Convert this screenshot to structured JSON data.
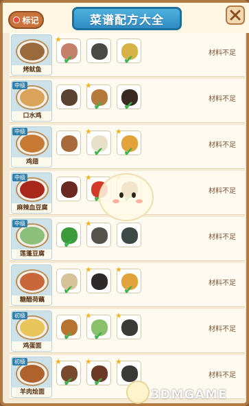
{
  "header": {
    "tag_label": "标记",
    "title": "菜谱配方大全",
    "close_icon": "close-icon"
  },
  "recipes": [
    {
      "name": "烤鱿鱼",
      "tier": "",
      "status": "材料不足",
      "food_color": "#9a6a3c",
      "ingredients": [
        {
          "icon": "squid-icon",
          "color": "#c4806a",
          "starred": true,
          "owned": true
        },
        {
          "icon": "iron-pan-icon",
          "color": "#4a4a44",
          "starred": false,
          "owned": false
        },
        {
          "icon": "oil-bottle-icon",
          "color": "#d7b347",
          "starred": false,
          "owned": true
        }
      ]
    },
    {
      "name": "口水鸡",
      "tier": "中级",
      "status": "材料不足",
      "food_color": "#d9a45a",
      "ingredients": [
        {
          "icon": "sichuan-pepper-icon",
          "color": "#5a4330",
          "starred": false,
          "owned": false
        },
        {
          "icon": "peanut-icon",
          "color": "#b47a3c",
          "starred": true,
          "owned": true
        },
        {
          "icon": "soy-sauce-icon",
          "color": "#3a2a22",
          "starred": false,
          "owned": true
        }
      ]
    },
    {
      "name": "鸡翅",
      "tier": "中级",
      "status": "材料不足",
      "food_color": "#c87a34",
      "ingredients": [
        {
          "icon": "chicken-wing-icon",
          "color": "#a86a3a",
          "starred": false,
          "owned": false
        },
        {
          "icon": "sugar-icon",
          "color": "#e8e0c8",
          "starred": true,
          "owned": true
        },
        {
          "icon": "honey-jar-icon",
          "color": "#e2a43a",
          "starred": true,
          "owned": true
        }
      ]
    },
    {
      "name": "麻辣血豆腐",
      "tier": "中级",
      "status": "材料不足",
      "food_color": "#a8281c",
      "ingredients": [
        {
          "icon": "blood-tofu-icon",
          "color": "#6a2a22",
          "starred": false,
          "owned": false
        },
        {
          "icon": "chili-icon",
          "color": "#d43a2a",
          "starred": true,
          "owned": true
        },
        {
          "icon": "spice-mix-icon",
          "color": "#b06a3a",
          "starred": true,
          "owned": true
        }
      ]
    },
    {
      "name": "莲蓬豆腐",
      "tier": "中级",
      "status": "材料不足",
      "food_color": "#8cc07a",
      "ingredients": [
        {
          "icon": "broccoli-icon",
          "color": "#3c9a3a",
          "starred": false,
          "owned": true
        },
        {
          "icon": "tofu-icon",
          "color": "#54524a",
          "starred": true,
          "owned": false
        },
        {
          "icon": "starch-bag-icon",
          "color": "#3e4a48",
          "starred": false,
          "owned": false
        }
      ]
    },
    {
      "name": "糖醋荷藕",
      "tier": "",
      "status": "材料不足",
      "food_color": "#c8683a",
      "ingredients": [
        {
          "icon": "lotus-root-icon",
          "color": "#d7c29a",
          "starred": false,
          "owned": true
        },
        {
          "icon": "vinegar-bottle-icon",
          "color": "#2e2a2a",
          "starred": true,
          "owned": false
        },
        {
          "icon": "honey-jar-icon",
          "color": "#e2a43a",
          "starred": true,
          "owned": true
        }
      ]
    },
    {
      "name": "鸡蛋面",
      "tier": "初级",
      "status": "材料不足",
      "food_color": "#e8c45a",
      "ingredients": [
        {
          "icon": "egg-icon",
          "color": "#b8742e",
          "starred": false,
          "owned": true
        },
        {
          "icon": "bok-choy-icon",
          "color": "#8ac06a",
          "starred": true,
          "owned": true
        },
        {
          "icon": "noodles-icon",
          "color": "#3a3a36",
          "starred": true,
          "owned": false
        }
      ]
    },
    {
      "name": "羊肉烩面",
      "tier": "初级",
      "status": "材料不足",
      "food_color": "#b0622c",
      "ingredients": [
        {
          "icon": "mutton-icon",
          "color": "#7a4a2c",
          "starred": true,
          "owned": true
        },
        {
          "icon": "mushroom-icon",
          "color": "#6a3a26",
          "starred": true,
          "owned": true
        },
        {
          "icon": "noodles-icon",
          "color": "#3a3a36",
          "starred": true,
          "owned": false
        }
      ]
    }
  ],
  "watermark": "3DMGAME"
}
